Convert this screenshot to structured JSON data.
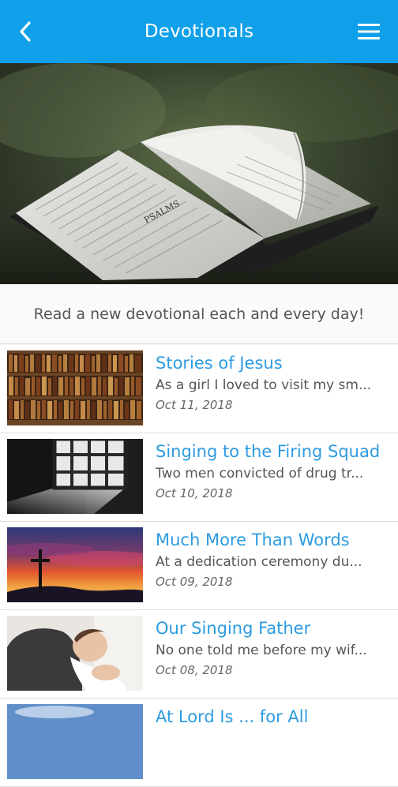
{
  "header": {
    "title": "Devotionals",
    "back_icon": "chevron-left-icon",
    "menu_icon": "hamburger-menu-icon"
  },
  "hero": {
    "alt": "open-bible-photo",
    "page_heading": "PSALMS"
  },
  "tagline": "Read a new devotional each and every day!",
  "devotionals": [
    {
      "title": "Stories of Jesus",
      "excerpt": "As a girl I loved to visit my sm...",
      "date": "Oct 11, 2018",
      "image": "bookshelf"
    },
    {
      "title": "Singing to the Firing Squad",
      "excerpt": "Two men convicted of drug tr...",
      "date": "Oct 10, 2018",
      "image": "prison-window"
    },
    {
      "title": "Much More Than Words",
      "excerpt": "At a dedication ceremony du...",
      "date": "Oct 09, 2018",
      "image": "cross-sunset"
    },
    {
      "title": "Our Singing Father",
      "excerpt": "No one told me before my wif...",
      "date": "Oct 08, 2018",
      "image": "father-baby"
    },
    {
      "title": "At Lord Is ... for All",
      "excerpt": "",
      "date": "",
      "image": "sky"
    }
  ],
  "colors": {
    "appbar": "#10a0ea",
    "title_text": "#2d9be0"
  }
}
